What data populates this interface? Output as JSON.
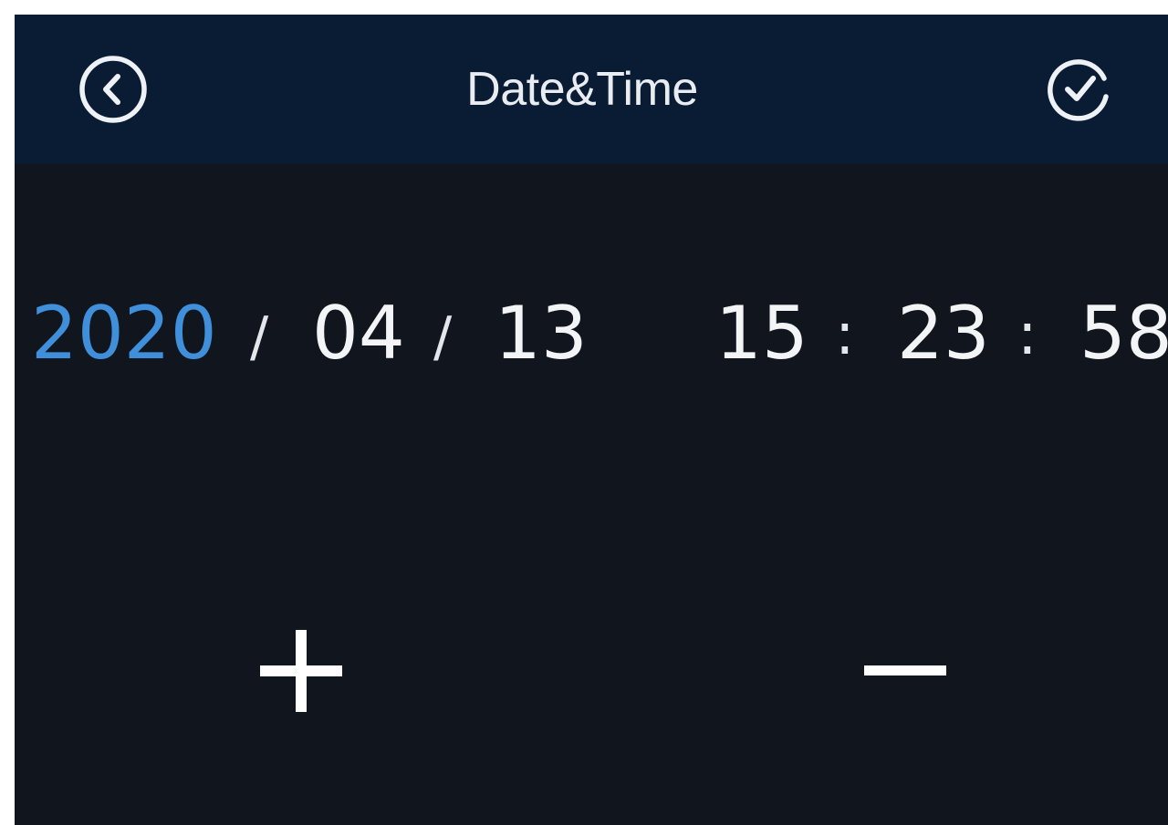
{
  "header": {
    "title": "Date&Time",
    "back_icon": "chevron-left-circle-icon",
    "confirm_icon": "check-circle-icon"
  },
  "datetime": {
    "year": "2020",
    "month": "04",
    "day": "13",
    "hour": "15",
    "minute": "23",
    "second": "58",
    "date_separator": "/",
    "time_separator": ":",
    "selected_field": "year"
  },
  "controls": {
    "increment_icon": "plus-icon",
    "decrement_icon": "minus-icon"
  },
  "colors": {
    "header_bg": "#0a1c33",
    "body_bg": "#11161e",
    "selected_text": "#3f8fda",
    "text": "#f2f4f6"
  }
}
